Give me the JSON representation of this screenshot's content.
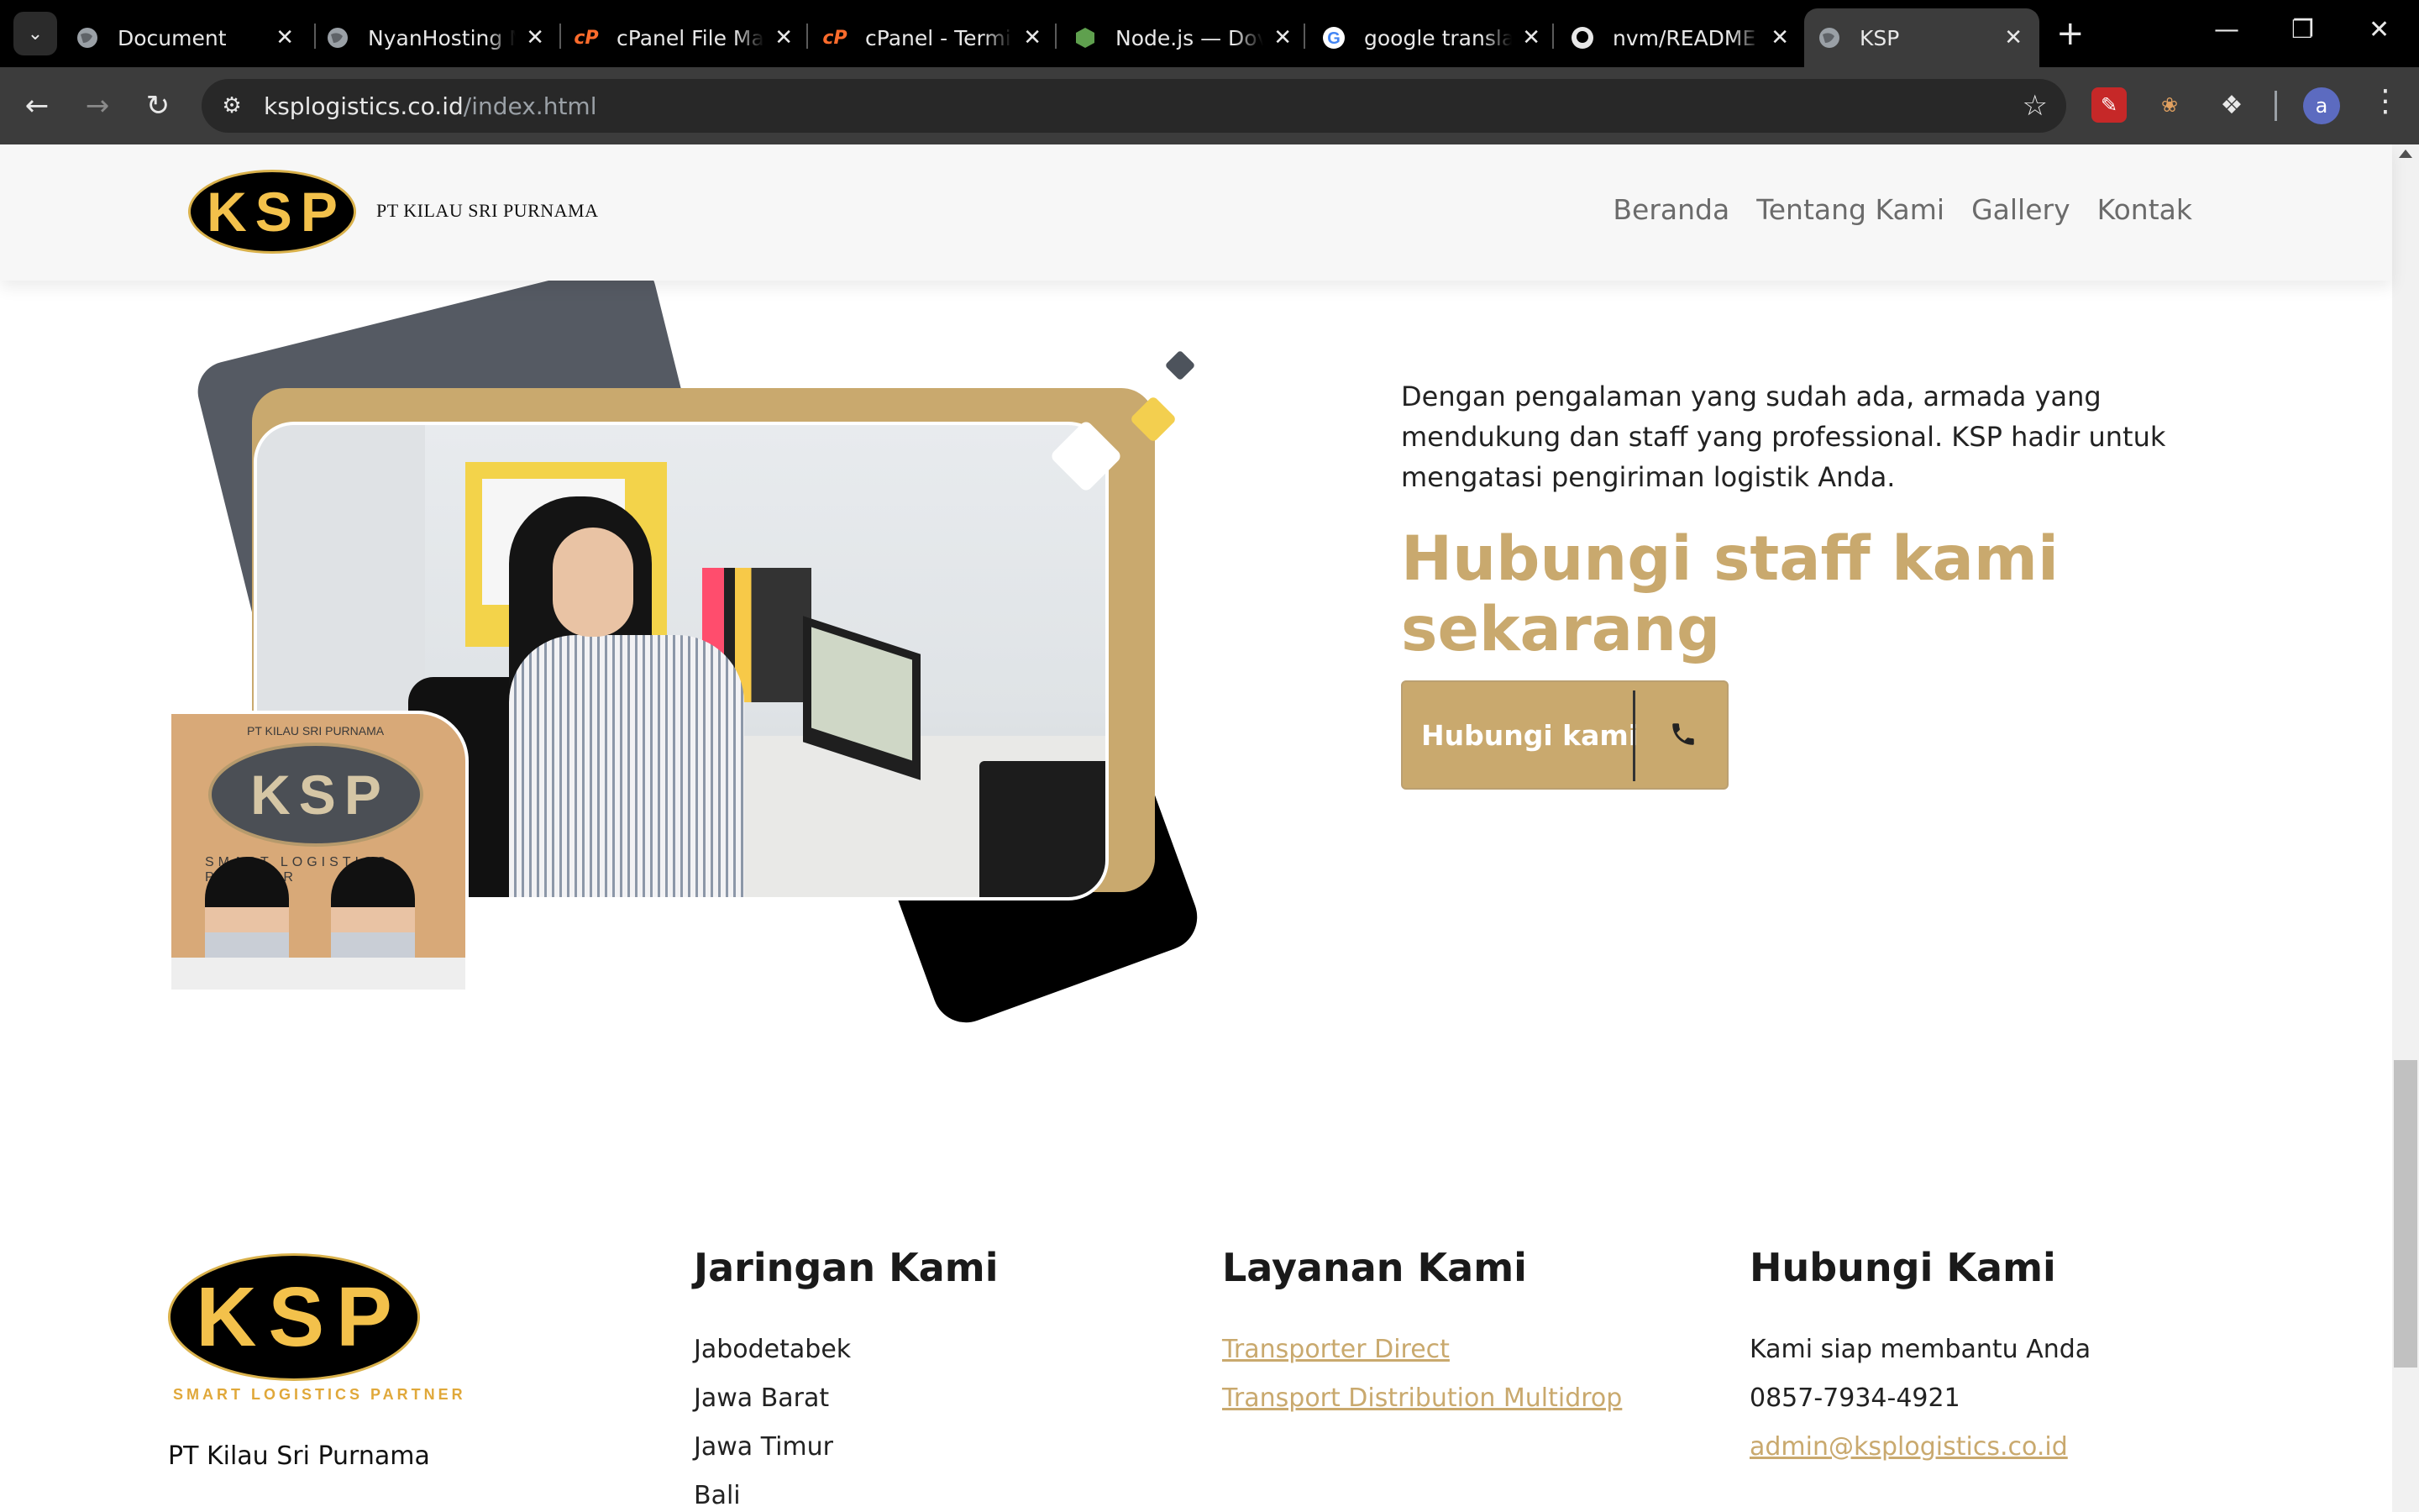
{
  "browser": {
    "tabs": [
      {
        "title": "Document",
        "icon": "globe-icon"
      },
      {
        "title": "NyanHosting M",
        "icon": "globe-icon"
      },
      {
        "title": "cPanel File Ma",
        "icon": "cpanel-icon"
      },
      {
        "title": "cPanel - Termi",
        "icon": "cpanel-icon"
      },
      {
        "title": "Node.js — Dov",
        "icon": "nodejs-icon"
      },
      {
        "title": "google transla",
        "icon": "google-icon"
      },
      {
        "title": "nvm/README",
        "icon": "github-icon"
      },
      {
        "title": "KSP",
        "icon": "globe-icon",
        "active": true
      }
    ],
    "url_domain": "ksplogistics.co.id",
    "url_path": "/index.html",
    "profile_initial": "a",
    "colors": {
      "chrome_dark": "#000000",
      "toolbar": "#3c3c3c",
      "omnibox": "#282828"
    }
  },
  "site": {
    "logo_text": "KSP",
    "brand_name": "PT KILAU SRI PURNAMA",
    "nav": [
      "Beranda",
      "Tentang Kami",
      "Gallery",
      "Kontak"
    ],
    "colors": {
      "accent": "#c9a96e",
      "logo_yellow": "#f3c14b",
      "slate": "#555a63"
    }
  },
  "hero": {
    "intro": "Dengan pengalaman yang sudah ada, armada yang mendukung dan staff yang professional. KSP hadir untuk mengatasi pengiriman logistik Anda.",
    "cta_title": "Hubungi staff kami sekarang",
    "cta_button": "Hubungi kami",
    "small_photo_top": "PT KILAU SRI PURNAMA",
    "small_photo_logo": "KSP",
    "small_photo_tag": "SMART LOGISTICS PARTNER"
  },
  "footer": {
    "logo_text": "KSP",
    "logo_tagline": "SMART LOGISTICS PARTNER",
    "company": "PT Kilau Sri Purnama",
    "network": {
      "title": "Jaringan Kami",
      "items": [
        "Jabodetabek",
        "Jawa Barat",
        "Jawa Timur",
        "Bali"
      ]
    },
    "services": {
      "title": "Layanan Kami",
      "items": [
        "Transporter Direct",
        "Transport Distribution Multidrop"
      ]
    },
    "contact": {
      "title": "Hubungi Kami",
      "tagline": "Kami siap membantu Anda",
      "phone": "0857-7934-4921",
      "email": "admin@ksplogistics.co.id"
    }
  }
}
